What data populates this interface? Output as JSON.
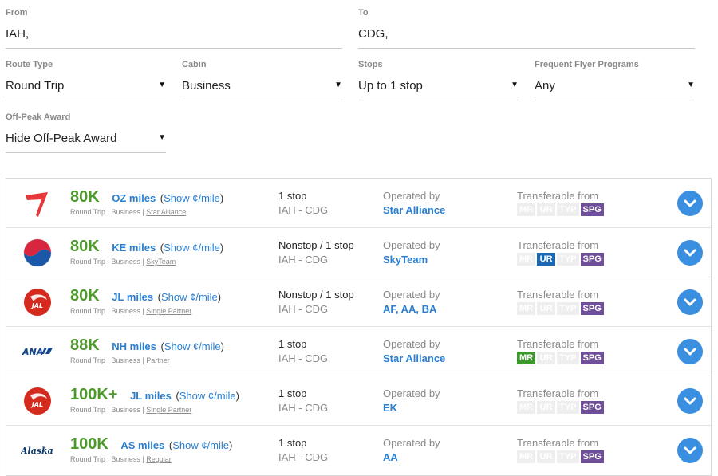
{
  "form": {
    "from": {
      "label": "From",
      "value": "IAH,"
    },
    "to": {
      "label": "To",
      "value": "CDG,"
    },
    "route_type": {
      "label": "Route Type",
      "value": "Round Trip"
    },
    "cabin": {
      "label": "Cabin",
      "value": "Business"
    },
    "stops": {
      "label": "Stops",
      "value": "Up to 1 stop"
    },
    "ffp": {
      "label": "Frequent Flyer Programs",
      "value": "Any"
    },
    "offpeak": {
      "label": "Off-Peak Award",
      "value": "Hide Off-Peak Award"
    }
  },
  "results": [
    {
      "logo": "asiana-logo",
      "miles": "80K",
      "program": "OZ miles",
      "show": "Show ¢/mile",
      "sub_trip": "Round Trip",
      "sub_cabin": "Business",
      "sub_partner": "Star Alliance",
      "stops": "1 stop",
      "route": "IAH - CDG",
      "op_label": "Operated by",
      "op": "Star Alliance",
      "tr_label": "Transferable from",
      "badges": [
        {
          "t": "MR",
          "on": false
        },
        {
          "t": "UR",
          "on": false
        },
        {
          "t": "TYP",
          "on": false
        },
        {
          "t": "SPG",
          "on": true
        }
      ]
    },
    {
      "logo": "korean-air-logo",
      "miles": "80K",
      "program": "KE miles",
      "show": "Show ¢/mile",
      "sub_trip": "Round Trip",
      "sub_cabin": "Business",
      "sub_partner": "SkyTeam",
      "stops": "Nonstop / 1 stop",
      "route": "IAH - CDG",
      "op_label": "Operated by",
      "op": "SkyTeam",
      "tr_label": "Transferable from",
      "badges": [
        {
          "t": "MR",
          "on": false
        },
        {
          "t": "UR",
          "on": true
        },
        {
          "t": "TYP",
          "on": false
        },
        {
          "t": "SPG",
          "on": true
        }
      ]
    },
    {
      "logo": "jal-logo",
      "miles": "80K",
      "program": "JL miles",
      "show": "Show ¢/mile",
      "sub_trip": "Round Trip",
      "sub_cabin": "Business",
      "sub_partner": "Single Partner",
      "stops": "Nonstop / 1 stop",
      "route": "IAH - CDG",
      "op_label": "Operated by",
      "op": "AF, AA, BA",
      "tr_label": "Transferable from",
      "badges": [
        {
          "t": "MR",
          "on": false
        },
        {
          "t": "UR",
          "on": false
        },
        {
          "t": "TYP",
          "on": false
        },
        {
          "t": "SPG",
          "on": true
        }
      ]
    },
    {
      "logo": "ana-logo",
      "miles": "88K",
      "program": "NH miles",
      "show": "Show ¢/mile",
      "sub_trip": "Round Trip",
      "sub_cabin": "Business",
      "sub_partner": "Partner",
      "stops": "1 stop",
      "route": "IAH - CDG",
      "op_label": "Operated by",
      "op": "Star Alliance",
      "tr_label": "Transferable from",
      "badges": [
        {
          "t": "MR",
          "on": true
        },
        {
          "t": "UR",
          "on": false
        },
        {
          "t": "TYP",
          "on": false
        },
        {
          "t": "SPG",
          "on": true
        }
      ]
    },
    {
      "logo": "jal-logo",
      "miles": "100K+",
      "program": "JL miles",
      "show": "Show ¢/mile",
      "sub_trip": "Round Trip",
      "sub_cabin": "Business",
      "sub_partner": "Single Partner",
      "stops": "1 stop",
      "route": "IAH - CDG",
      "op_label": "Operated by",
      "op": "EK",
      "tr_label": "Transferable from",
      "badges": [
        {
          "t": "MR",
          "on": false
        },
        {
          "t": "UR",
          "on": false
        },
        {
          "t": "TYP",
          "on": false
        },
        {
          "t": "SPG",
          "on": true
        }
      ]
    },
    {
      "logo": "alaska-logo",
      "miles": "100K",
      "program": "AS miles",
      "show": "Show ¢/mile",
      "sub_trip": "Round Trip",
      "sub_cabin": "Business",
      "sub_partner": "Regular",
      "stops": "1 stop",
      "route": "IAH - CDG",
      "op_label": "Operated by",
      "op": "AA",
      "tr_label": "Transferable from",
      "badges": [
        {
          "t": "MR",
          "on": false
        },
        {
          "t": "UR",
          "on": false
        },
        {
          "t": "TYP",
          "on": false
        },
        {
          "t": "SPG",
          "on": true
        }
      ]
    }
  ],
  "logo_text": {
    "jal": "JAL",
    "ana": "ANA",
    "alaska": "Alaska"
  },
  "colors": {
    "miles_green": "#4c9a2a",
    "link_blue": "#2a7fd0",
    "mr_green": "#3c9a2c",
    "ur_blue": "#1a67b3",
    "spg_purple": "#6f4f9a"
  }
}
